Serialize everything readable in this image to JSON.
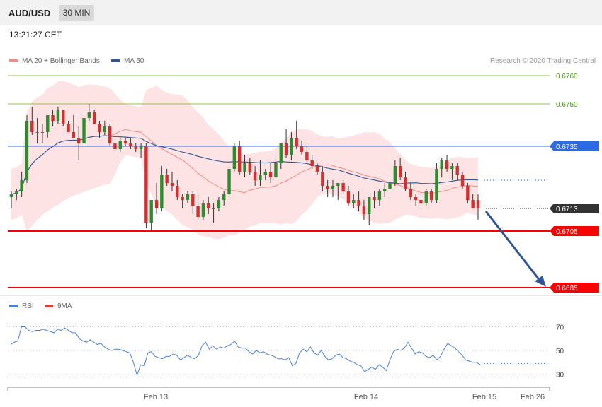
{
  "header": {
    "symbol": "AUD/USD",
    "timeframe": "30 MIN",
    "time": "13:21:27 CET"
  },
  "legend_main": [
    {
      "label": "MA 20 + Bollinger Bands",
      "color": "#f28b82"
    },
    {
      "label": "MA 50",
      "color": "#2f5597"
    }
  ],
  "credit": "Research © 2020 Trading Central",
  "legend_rsi": [
    {
      "label": "RSI",
      "color": "#4a7fd6"
    },
    {
      "label": "9MA",
      "color": "#e53935"
    }
  ],
  "colors": {
    "bull": "#2e8b2e",
    "bear": "#d32f2f",
    "band": "#fde3e3",
    "ma20": "#f28b82",
    "ma50": "#2f5597",
    "support": "#ff0000",
    "resistance": "#8bc34a",
    "pivot": "#2d6be4",
    "arrow": "#2f5597"
  },
  "chart_data": [
    {
      "type": "candlestick",
      "title": "AUD/USD",
      "ylim": [
        0.6678,
        0.6775
      ],
      "price_levels": [
        {
          "value": "0.6760",
          "role": "resistance"
        },
        {
          "value": "0.6750",
          "role": "resistance"
        },
        {
          "value": "0.6735",
          "role": "pivot"
        },
        {
          "value": "0.6713",
          "role": "current"
        },
        {
          "value": "0.6705",
          "role": "support"
        },
        {
          "value": "0.6685",
          "role": "support"
        }
      ],
      "x_ticks": [
        "Feb 13",
        "Feb 14",
        "Feb 15",
        "Feb 26"
      ],
      "candles": [
        [
          0.6717,
          0.6719,
          0.6713,
          0.6718
        ],
        [
          0.6718,
          0.672,
          0.6716,
          0.6719
        ],
        [
          0.6719,
          0.6726,
          0.6717,
          0.6723
        ],
        [
          0.6723,
          0.6746,
          0.6722,
          0.6744
        ],
        [
          0.6744,
          0.6749,
          0.6739,
          0.674
        ],
        [
          0.674,
          0.6745,
          0.6736,
          0.674
        ],
        [
          0.674,
          0.6743,
          0.6736,
          0.674
        ],
        [
          0.674,
          0.6746,
          0.6738,
          0.6746
        ],
        [
          0.6746,
          0.6748,
          0.6742,
          0.6744
        ],
        [
          0.6744,
          0.6749,
          0.6743,
          0.6748
        ],
        [
          0.6748,
          0.6748,
          0.6742,
          0.6743
        ],
        [
          0.6743,
          0.6744,
          0.674,
          0.674
        ],
        [
          0.674,
          0.6746,
          0.6738,
          0.6738
        ],
        [
          0.6738,
          0.6742,
          0.673,
          0.6736
        ],
        [
          0.6736,
          0.6746,
          0.6735,
          0.6745
        ],
        [
          0.6745,
          0.675,
          0.6744,
          0.6747
        ],
        [
          0.6747,
          0.6748,
          0.6743,
          0.6743
        ],
        [
          0.6743,
          0.6744,
          0.6738,
          0.674
        ],
        [
          0.674,
          0.6744,
          0.6739,
          0.6742
        ],
        [
          0.6742,
          0.6743,
          0.6735,
          0.6736
        ],
        [
          0.6736,
          0.6737,
          0.6734,
          0.6734
        ],
        [
          0.6734,
          0.6738,
          0.6733,
          0.6737
        ],
        [
          0.6737,
          0.6738,
          0.6735,
          0.6736
        ],
        [
          0.6736,
          0.6738,
          0.6734,
          0.6735
        ],
        [
          0.6735,
          0.6736,
          0.6733,
          0.6734
        ],
        [
          0.6734,
          0.6736,
          0.6731,
          0.6735
        ],
        [
          0.6735,
          0.6736,
          0.6706,
          0.6708
        ],
        [
          0.6708,
          0.6715,
          0.6705,
          0.6716
        ],
        [
          0.6716,
          0.6722,
          0.6711,
          0.6713
        ],
        [
          0.6713,
          0.6728,
          0.6712,
          0.6725
        ],
        [
          0.6725,
          0.6727,
          0.6721,
          0.6722
        ],
        [
          0.6722,
          0.6726,
          0.6719,
          0.6721
        ],
        [
          0.6721,
          0.6723,
          0.6716,
          0.6717
        ],
        [
          0.6717,
          0.6718,
          0.6713,
          0.6716
        ],
        [
          0.6716,
          0.6719,
          0.6715,
          0.6718
        ],
        [
          0.6718,
          0.6719,
          0.6711,
          0.6714
        ],
        [
          0.6714,
          0.6718,
          0.6709,
          0.671
        ],
        [
          0.671,
          0.6716,
          0.6709,
          0.6715
        ],
        [
          0.6715,
          0.6717,
          0.6711,
          0.6713
        ],
        [
          0.6713,
          0.6715,
          0.6708,
          0.6713
        ],
        [
          0.6713,
          0.6717,
          0.6712,
          0.6716
        ],
        [
          0.6716,
          0.6719,
          0.6714,
          0.6718
        ],
        [
          0.6718,
          0.6728,
          0.6716,
          0.6727
        ],
        [
          0.6727,
          0.6736,
          0.6726,
          0.6735
        ],
        [
          0.6735,
          0.6737,
          0.6725,
          0.6726
        ],
        [
          0.6726,
          0.6732,
          0.6724,
          0.6729
        ],
        [
          0.6729,
          0.6731,
          0.6725,
          0.6726
        ],
        [
          0.6726,
          0.6728,
          0.6721,
          0.6723
        ],
        [
          0.6723,
          0.673,
          0.6721,
          0.6725
        ],
        [
          0.6725,
          0.6727,
          0.6723,
          0.6726
        ],
        [
          0.6726,
          0.6729,
          0.6722,
          0.6724
        ],
        [
          0.6724,
          0.6731,
          0.6723,
          0.6729
        ],
        [
          0.6729,
          0.6735,
          0.6727,
          0.6736
        ],
        [
          0.6736,
          0.6741,
          0.6731,
          0.6732
        ],
        [
          0.6732,
          0.674,
          0.673,
          0.6738
        ],
        [
          0.6738,
          0.6744,
          0.6734,
          0.6735
        ],
        [
          0.6735,
          0.6737,
          0.6732,
          0.6733
        ],
        [
          0.6733,
          0.6735,
          0.6729,
          0.673
        ],
        [
          0.673,
          0.6732,
          0.6727,
          0.6728
        ],
        [
          0.6728,
          0.6729,
          0.6725,
          0.6726
        ],
        [
          0.6726,
          0.6728,
          0.6719,
          0.6721
        ],
        [
          0.6721,
          0.6723,
          0.6717,
          0.672
        ],
        [
          0.672,
          0.6723,
          0.6717,
          0.6721
        ],
        [
          0.6721,
          0.6722,
          0.6716,
          0.6722
        ],
        [
          0.6722,
          0.6723,
          0.6718,
          0.6719
        ],
        [
          0.6719,
          0.6721,
          0.6714,
          0.6715
        ],
        [
          0.6715,
          0.6718,
          0.6713,
          0.6716
        ],
        [
          0.6716,
          0.6719,
          0.6712,
          0.6714
        ],
        [
          0.6714,
          0.6716,
          0.6709,
          0.6711
        ],
        [
          0.6711,
          0.6717,
          0.6707,
          0.6717
        ],
        [
          0.6717,
          0.6719,
          0.6713,
          0.6716
        ],
        [
          0.6716,
          0.672,
          0.6714,
          0.6719
        ],
        [
          0.6719,
          0.6722,
          0.6717,
          0.672
        ],
        [
          0.672,
          0.6723,
          0.6718,
          0.6722
        ],
        [
          0.6722,
          0.673,
          0.6721,
          0.6728
        ],
        [
          0.6728,
          0.6731,
          0.6723,
          0.6724
        ],
        [
          0.6724,
          0.6726,
          0.6719,
          0.672
        ],
        [
          0.672,
          0.6722,
          0.6716,
          0.6717
        ],
        [
          0.6717,
          0.6718,
          0.6714,
          0.6716
        ],
        [
          0.6716,
          0.6718,
          0.6714,
          0.6715
        ],
        [
          0.6715,
          0.672,
          0.6714,
          0.6719
        ],
        [
          0.6719,
          0.672,
          0.6715,
          0.6716
        ],
        [
          0.6716,
          0.6729,
          0.6715,
          0.6727
        ],
        [
          0.6727,
          0.6731,
          0.6724,
          0.673
        ],
        [
          0.673,
          0.6732,
          0.6726,
          0.6727
        ],
        [
          0.6727,
          0.6729,
          0.6723,
          0.6728
        ],
        [
          0.6728,
          0.6729,
          0.6723,
          0.6725
        ],
        [
          0.6725,
          0.6726,
          0.672,
          0.6721
        ],
        [
          0.6721,
          0.6722,
          0.6715,
          0.6716
        ],
        [
          0.6716,
          0.6718,
          0.6713,
          0.6713
        ],
        [
          0.6716,
          0.6718,
          0.6709,
          0.6713
        ]
      ]
    },
    {
      "type": "line",
      "title": "RSI",
      "ylim": [
        20,
        80
      ],
      "y_ticks": [
        "70",
        "50",
        "30"
      ],
      "series": [
        {
          "name": "RSI",
          "values": [
            55,
            57,
            58,
            70,
            70,
            67,
            66,
            67,
            67,
            68,
            67,
            66,
            65,
            68,
            67,
            69,
            67,
            65,
            65,
            60,
            58,
            57,
            59,
            57,
            55,
            56,
            53,
            51,
            50,
            51,
            51,
            50,
            49,
            48,
            40,
            29,
            38,
            37,
            48,
            49,
            45,
            44,
            43,
            45,
            45,
            47,
            46,
            42,
            44,
            46,
            44,
            43,
            46,
            54,
            57,
            51,
            54,
            51,
            53,
            52,
            54,
            55,
            58,
            53,
            52,
            52,
            49,
            47,
            50,
            48,
            49,
            47,
            46,
            45,
            43,
            43,
            42,
            44,
            37,
            39,
            48,
            51,
            49,
            53,
            48,
            46,
            50,
            45,
            42,
            43,
            46,
            47,
            44,
            43,
            41,
            40,
            38,
            37,
            32,
            34,
            36,
            34,
            38,
            36,
            33,
            42,
            49,
            51,
            50,
            52,
            57,
            52,
            47,
            49,
            48,
            45,
            44,
            46,
            42,
            45,
            51,
            56,
            54,
            52,
            49,
            46,
            42,
            41,
            40,
            40,
            38
          ]
        }
      ],
      "x_ticks": [
        "Feb 13",
        "Feb 14",
        "Feb 15",
        "Feb 26"
      ]
    }
  ]
}
